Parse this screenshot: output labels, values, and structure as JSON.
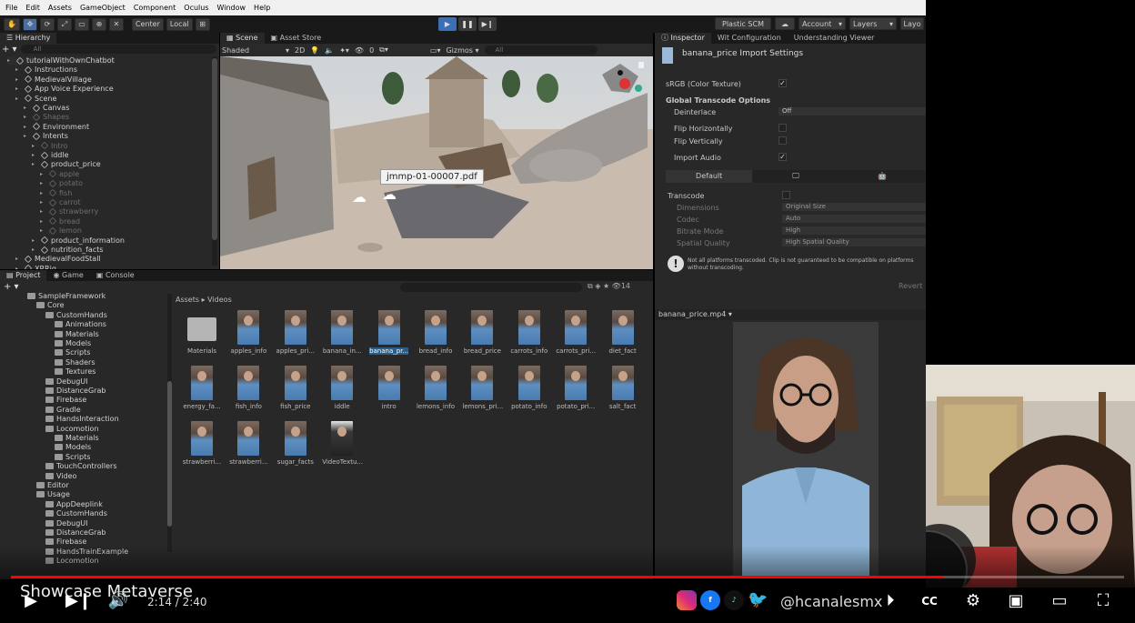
{
  "menubar": {
    "items": [
      "File",
      "Edit",
      "Assets",
      "GameObject",
      "Component",
      "Oculus",
      "Window",
      "Help"
    ]
  },
  "toolbar": {
    "center": "Center",
    "local": "Local",
    "plastic": "Plastic SCM",
    "account": "Account",
    "layers": "Layers",
    "layout": "Layo"
  },
  "hierarchy": {
    "tab": "Hierarchy",
    "search_placeholder": "All",
    "items": [
      {
        "label": "tutorialWithOwnChatbot",
        "indent": 0,
        "type": "scene",
        "dim": false
      },
      {
        "label": "Instructions",
        "indent": 1,
        "type": "cube",
        "dim": false
      },
      {
        "label": "MedievalVillage",
        "indent": 1,
        "type": "cube",
        "dim": false
      },
      {
        "label": "App Voice Experience",
        "indent": 1,
        "type": "cube",
        "dim": false
      },
      {
        "label": "Scene",
        "indent": 1,
        "type": "cube",
        "dim": false
      },
      {
        "label": "Canvas",
        "indent": 2,
        "type": "cube",
        "dim": false
      },
      {
        "label": "Shapes",
        "indent": 2,
        "type": "cube",
        "dim": true
      },
      {
        "label": "Environment",
        "indent": 2,
        "type": "cube",
        "dim": false
      },
      {
        "label": "Intents",
        "indent": 2,
        "type": "cube",
        "dim": false
      },
      {
        "label": "Intro",
        "indent": 3,
        "type": "cube",
        "dim": true
      },
      {
        "label": "iddle",
        "indent": 3,
        "type": "cube",
        "dim": false
      },
      {
        "label": "product_price",
        "indent": 3,
        "type": "cube",
        "dim": false
      },
      {
        "label": "apple",
        "indent": 4,
        "type": "cube",
        "dim": true
      },
      {
        "label": "potato",
        "indent": 4,
        "type": "cube",
        "dim": true
      },
      {
        "label": "fish",
        "indent": 4,
        "type": "cube",
        "dim": true
      },
      {
        "label": "carrot",
        "indent": 4,
        "type": "cube",
        "dim": true
      },
      {
        "label": "strawberry",
        "indent": 4,
        "type": "cube",
        "dim": true
      },
      {
        "label": "bread",
        "indent": 4,
        "type": "cube",
        "dim": true
      },
      {
        "label": "lemon",
        "indent": 4,
        "type": "cube",
        "dim": true
      },
      {
        "label": "product_information",
        "indent": 3,
        "type": "cube",
        "dim": false
      },
      {
        "label": "nutrition_facts",
        "indent": 3,
        "type": "cube",
        "dim": false
      },
      {
        "label": "MedievalFoodStall",
        "indent": 1,
        "type": "cube",
        "dim": false
      },
      {
        "label": "XRRig",
        "indent": 1,
        "type": "cube",
        "dim": false
      }
    ]
  },
  "scene_tabs": {
    "scene": "Scene",
    "asset_store": "Asset Store",
    "shaded": "Shaded",
    "dim_2d": "2D",
    "gizmos": "Gizmos",
    "search_placeholder": "All",
    "hidden_count": "0"
  },
  "scene_overlay": {
    "tooltip": "jmmp-01-00007.pdf"
  },
  "project": {
    "tabs": [
      "Project",
      "Game",
      "Console"
    ],
    "breadcrumb_root": "Assets",
    "breadcrumb_current": "Videos",
    "item_count": "14",
    "tree": [
      {
        "label": "SampleFramework",
        "indent": 0
      },
      {
        "label": "Core",
        "indent": 1
      },
      {
        "label": "CustomHands",
        "indent": 2
      },
      {
        "label": "Animations",
        "indent": 3
      },
      {
        "label": "Materials",
        "indent": 3
      },
      {
        "label": "Models",
        "indent": 3
      },
      {
        "label": "Scripts",
        "indent": 3
      },
      {
        "label": "Shaders",
        "indent": 3
      },
      {
        "label": "Textures",
        "indent": 3
      },
      {
        "label": "DebugUI",
        "indent": 2
      },
      {
        "label": "DistanceGrab",
        "indent": 2
      },
      {
        "label": "Firebase",
        "indent": 2
      },
      {
        "label": "Gradle",
        "indent": 2
      },
      {
        "label": "HandsInteraction",
        "indent": 2
      },
      {
        "label": "Locomotion",
        "indent": 2
      },
      {
        "label": "Materials",
        "indent": 3
      },
      {
        "label": "Models",
        "indent": 3
      },
      {
        "label": "Scripts",
        "indent": 3
      },
      {
        "label": "TouchControllers",
        "indent": 2
      },
      {
        "label": "Video",
        "indent": 2
      },
      {
        "label": "Editor",
        "indent": 1
      },
      {
        "label": "Usage",
        "indent": 1
      },
      {
        "label": "AppDeeplink",
        "indent": 2
      },
      {
        "label": "CustomHands",
        "indent": 2
      },
      {
        "label": "DebugUI",
        "indent": 2
      },
      {
        "label": "DistanceGrab",
        "indent": 2
      },
      {
        "label": "Firebase",
        "indent": 2
      },
      {
        "label": "HandsTrainExample",
        "indent": 2
      },
      {
        "label": "Locomotion",
        "indent": 2
      }
    ],
    "assets": [
      {
        "label": "Materials",
        "kind": "folder"
      },
      {
        "label": "apples_info",
        "kind": "video"
      },
      {
        "label": "apples_pri...",
        "kind": "video"
      },
      {
        "label": "banana_in...",
        "kind": "video"
      },
      {
        "label": "banana_pr...",
        "kind": "video",
        "selected": true
      },
      {
        "label": "bread_info",
        "kind": "video"
      },
      {
        "label": "bread_price",
        "kind": "video"
      },
      {
        "label": "carrots_info",
        "kind": "video"
      },
      {
        "label": "carrots_pri...",
        "kind": "video"
      },
      {
        "label": "diet_fact",
        "kind": "video"
      },
      {
        "label": "energy_fa...",
        "kind": "video"
      },
      {
        "label": "fish_info",
        "kind": "video"
      },
      {
        "label": "fish_price",
        "kind": "video"
      },
      {
        "label": "iddle",
        "kind": "video"
      },
      {
        "label": "intro",
        "kind": "video"
      },
      {
        "label": "lemons_info",
        "kind": "video"
      },
      {
        "label": "lemons_pri...",
        "kind": "video"
      },
      {
        "label": "potato_info",
        "kind": "video"
      },
      {
        "label": "potato_pri...",
        "kind": "video"
      },
      {
        "label": "salt_fact",
        "kind": "video"
      },
      {
        "label": "strawberri...",
        "kind": "video"
      },
      {
        "label": "strawberri...",
        "kind": "video"
      },
      {
        "label": "sugar_facts",
        "kind": "video"
      },
      {
        "label": "VideoTextu...",
        "kind": "texture"
      }
    ]
  },
  "inspector": {
    "tabs": [
      "Inspector",
      "Wit Configuration",
      "Understanding Viewer"
    ],
    "title": "banana_price Import Settings",
    "srgb": "sRGB (Color Texture)",
    "global_header": "Global Transcode Options",
    "deinterlace": "Deinterlace",
    "deinterlace_val": "Off",
    "flip_h": "Flip Horizontally",
    "flip_v": "Flip Vertically",
    "import_audio": "Import Audio",
    "platform_default": "Default",
    "transcode": "Transcode",
    "dimensions": "Dimensions",
    "dimensions_val": "Original Size",
    "codec": "Codec",
    "codec_val": "Auto",
    "bitrate": "Bitrate Mode",
    "bitrate_val": "High",
    "spatial": "Spatial Quality",
    "spatial_val": "High Spatial Quality",
    "warning": "Not all platforms transcoded. Clip is not guaranteed to be compatible on platforms without transcoding.",
    "revert": "Revert",
    "preview_name": "banana_price.mp4"
  },
  "video": {
    "title": "Showcase Metaverse",
    "time": "2:14 / 2:40",
    "progress": 0.8375,
    "handle": "@hcanalesmx"
  }
}
